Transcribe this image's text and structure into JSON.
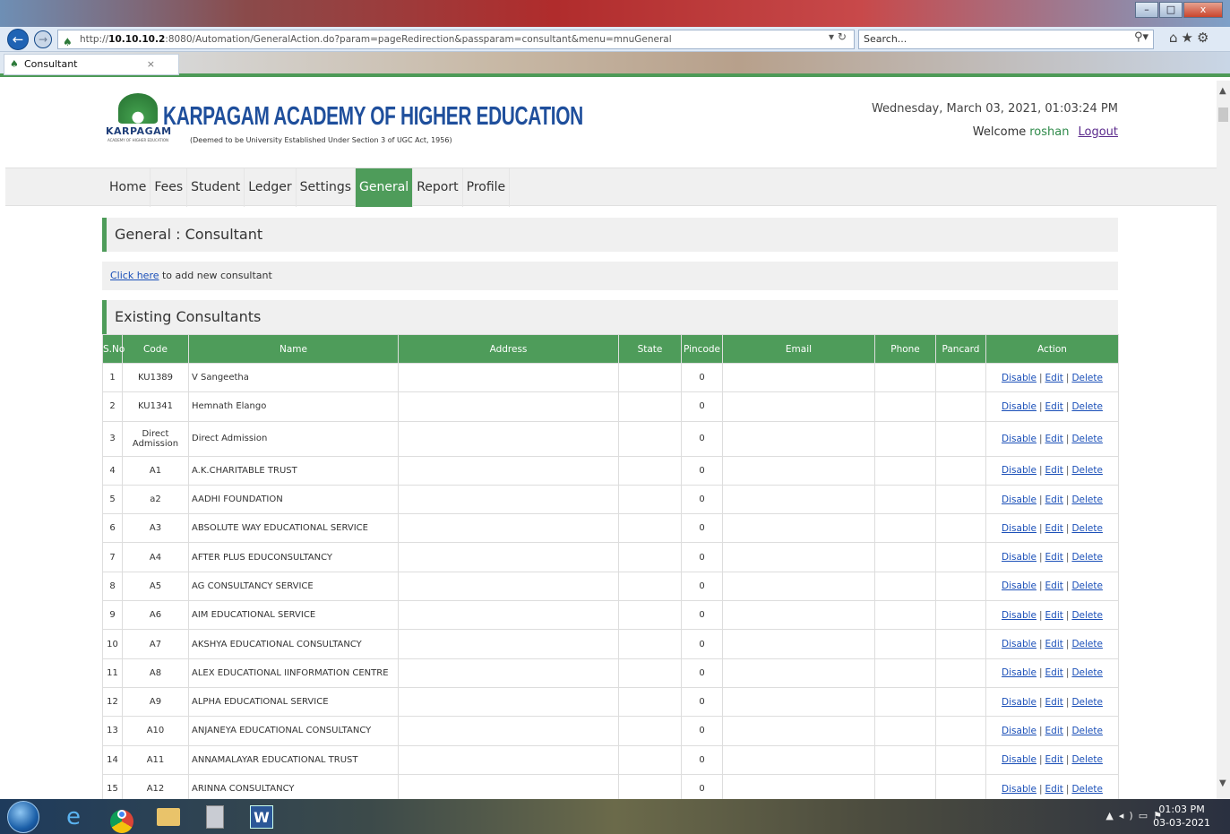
{
  "browser": {
    "url_prefix": "http://",
    "url_host": "10.10.10.2",
    "url_rest": ":8080/Automation/GeneralAction.do?param=pageRedirection&passparam=consultant&menu=mnuGeneral",
    "search_placeholder": "Search...",
    "tab_title": "Consultant",
    "tab_close": "×",
    "win_min": "–",
    "win_max": "□",
    "win_close": "x"
  },
  "header": {
    "logo_text": "KARPAGAM",
    "logo_subtext": "ACADEMY OF HIGHER EDUCATION",
    "title": "KARPAGAM ACADEMY OF HIGHER EDUCATION",
    "subtitle": "(Deemed to be University Established Under Section 3 of UGC Act, 1956)",
    "datetime": "Wednesday, March 03, 2021, 01:03:24 PM",
    "welcome_label": "Welcome",
    "username": "roshan",
    "logout_label": "Logout"
  },
  "menu": {
    "items": [
      "Home",
      "Fees",
      "Student",
      "Ledger",
      "Settings",
      "General",
      "Report",
      "Profile"
    ],
    "active": "General"
  },
  "page": {
    "section_title": "General : Consultant",
    "add_link": "Click here",
    "add_text": " to add new consultant",
    "list_title": "Existing Consultants"
  },
  "table": {
    "headers": [
      "S.No",
      "Code",
      "Name",
      "Address",
      "State",
      "Pincode",
      "Email",
      "Phone",
      "Pancard",
      "Action"
    ],
    "actions": [
      "Disable",
      "Edit",
      "Delete"
    ],
    "rows": [
      [
        "1",
        "KU1389",
        "V Sangeetha",
        "0"
      ],
      [
        "2",
        "KU1341",
        "Hemnath Elango",
        "0"
      ],
      [
        "3",
        "Direct Admission",
        "Direct Admission",
        "0"
      ],
      [
        "4",
        "A1",
        "A.K.CHARITABLE TRUST",
        "0"
      ],
      [
        "5",
        "a2",
        "AADHI FOUNDATION",
        "0"
      ],
      [
        "6",
        "A3",
        "ABSOLUTE WAY EDUCATIONAL SERVICE",
        "0"
      ],
      [
        "7",
        "A4",
        "AFTER PLUS EDUCONSULTANCY",
        "0"
      ],
      [
        "8",
        "A5",
        "AG CONSULTANCY SERVICE",
        "0"
      ],
      [
        "9",
        "A6",
        "AIM EDUCATIONAL SERVICE",
        "0"
      ],
      [
        "10",
        "A7",
        "AKSHYA EDUCATIONAL CONSULTANCY",
        "0"
      ],
      [
        "11",
        "A8",
        "ALEX EDUCATIONAL IINFORMATION CENTRE",
        "0"
      ],
      [
        "12",
        "A9",
        "ALPHA EDUCATIONAL SERVICE",
        "0"
      ],
      [
        "13",
        "A10",
        "ANJANEYA EDUCATIONAL CONSULTANCY",
        "0"
      ],
      [
        "14",
        "A11",
        "ANNAMALAYAR EDUCATIONAL TRUST",
        "0"
      ],
      [
        "15",
        "A12",
        "ARINNA CONSULTANCY",
        "0"
      ]
    ]
  },
  "taskbar": {
    "time": "01:03 PM",
    "date": "03-03-2021"
  },
  "colors": {
    "accent": "#4e9c5a",
    "link": "#1a4fb8",
    "brand": "#1f4f9c"
  }
}
